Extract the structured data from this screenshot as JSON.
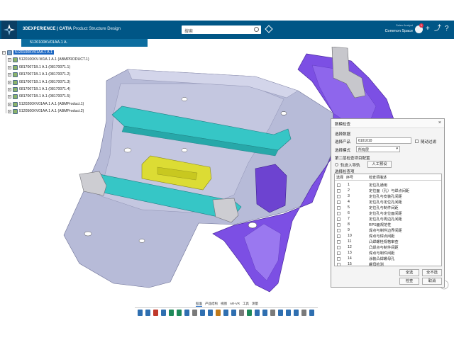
{
  "topbar": {
    "brand": "3DEXPERIENCE",
    "app_name": "| CATIA",
    "app_subtitle": "Product Structure Design",
    "search_placeholder": "搜索",
    "user_line1": "Sales Analyst",
    "user_line2": "Common Space",
    "notification_count": "1",
    "compass_label": "3D V.R"
  },
  "document_tab": {
    "title": "5120100KV01AA.1 A."
  },
  "tree": {
    "items": [
      {
        "label": "5120100KV01AA.1 A.1",
        "level": 0,
        "selected": true
      },
      {
        "label": "5120100KV-W1A.1 A.1 (ABMPRODUCT.1)",
        "level": 1,
        "selected": false
      },
      {
        "label": "08170071B.1 A.1 (08170071.1)",
        "level": 1,
        "selected": false
      },
      {
        "label": "08170071B.1 A.1 (08170071.2)",
        "level": 1,
        "selected": false
      },
      {
        "label": "08170071B.1 A.1 (08170071.3)",
        "level": 1,
        "selected": false
      },
      {
        "label": "08170071B.1 A.1 (08170071.4)",
        "level": 1,
        "selected": false
      },
      {
        "label": "08170071B.1 A.1 (08170071.5)",
        "level": 1,
        "selected": false
      },
      {
        "label": "5120200KV01AA.1 A.1 (ABMProduct.1)",
        "level": 1,
        "selected": false
      },
      {
        "label": "5120500KV01AA.1 A.1 (ABMProduct.2)",
        "level": 1,
        "selected": false
      }
    ]
  },
  "dialog": {
    "title": "数模检查",
    "section_data": "选择数据",
    "label_product": "选择产品",
    "product_value": "6101010",
    "auto_filter_label": "随动过滤",
    "label_mode": "选择模式",
    "mode_value": "所有层",
    "section_config": "第二层检查项目配置",
    "radio_import": "轨迹入导轨",
    "btn_manual": "人工预设",
    "section_select": "选择检查项",
    "col_select": "选择",
    "col_index": "序号",
    "col_desc": "检查项描述",
    "rows": [
      {
        "no": "1",
        "desc": "定位孔通用"
      },
      {
        "no": "2",
        "desc": "定位面（孔）与焊点间距"
      },
      {
        "no": "3",
        "desc": "定位孔与安装孔间距"
      },
      {
        "no": "4",
        "desc": "定位孔与定位孔间距"
      },
      {
        "no": "5",
        "desc": "定位孔与制件间距"
      },
      {
        "no": "6",
        "desc": "定位孔与定位面间距"
      },
      {
        "no": "7",
        "desc": "定位孔与周边孔间距"
      },
      {
        "no": "8",
        "desc": "RPS面规范性"
      },
      {
        "no": "9",
        "desc": "焊点与制件边界间距"
      },
      {
        "no": "10",
        "desc": "焊点与焊点间距"
      },
      {
        "no": "11",
        "desc": "凸焊螺栓规格审查"
      },
      {
        "no": "12",
        "desc": "凸焊点与制件间距"
      },
      {
        "no": "13",
        "desc": "焊点与制件间距"
      },
      {
        "no": "14",
        "desc": "涂装凸焊螺母孔"
      },
      {
        "no": "15",
        "desc": "螺母检测"
      }
    ],
    "btn_select_all": "全选",
    "btn_deselect_all": "全不选",
    "btn_check": "检查",
    "btn_cancel": "取消"
  },
  "actionbar": {
    "tabs": [
      "标准",
      "产品结构",
      "视图",
      "AR-VR",
      "工具",
      "测量"
    ],
    "active_tab": "标准"
  },
  "colors": {
    "topbar": "#005686",
    "floor_part": "#b4b8d8",
    "sill_part": "#7b4fe0",
    "crossmember": "#36c4c4",
    "yellow_plate": "#dede3a",
    "bracket": "#c8c8cc"
  }
}
